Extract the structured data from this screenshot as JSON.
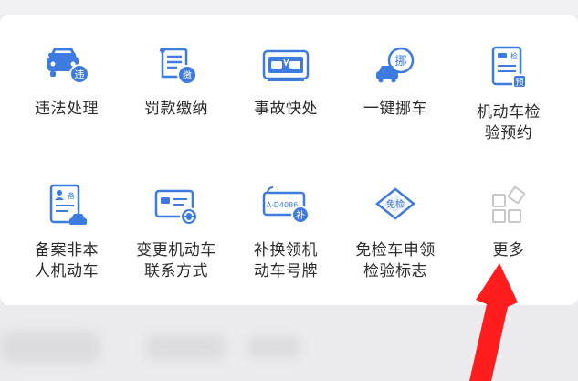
{
  "services": [
    {
      "label": "违法处理",
      "icon": "violation-car-icon",
      "badge": "违"
    },
    {
      "label": "罚款缴纳",
      "icon": "fine-bill-icon",
      "badge": "缴"
    },
    {
      "label": "事故快处",
      "icon": "accident-report-icon"
    },
    {
      "label": "一键挪车",
      "icon": "move-car-icon",
      "badge": "挪"
    },
    {
      "label": "机动车检\n验预约",
      "icon": "inspection-appointment-icon",
      "badge": "预",
      "tag": "检"
    },
    {
      "label": "备案非本\n人机动车",
      "icon": "register-vehicle-icon",
      "tag": "备"
    },
    {
      "label": "变更机动车\n联系方式",
      "icon": "change-contact-icon"
    },
    {
      "label": "补换领机\n动车号牌",
      "icon": "license-plate-icon",
      "badge": "补",
      "plate": "A·D4086"
    },
    {
      "label": "免检车申领\n检验标志",
      "icon": "exempt-sticker-icon",
      "tag": "免检"
    },
    {
      "label": "更多",
      "icon": "more-grid-icon"
    }
  ],
  "colors": {
    "accent": "#3d7be0",
    "arrow": "#ff1d1d",
    "text": "#2b2b2b",
    "muted": "#c8c8c8"
  }
}
